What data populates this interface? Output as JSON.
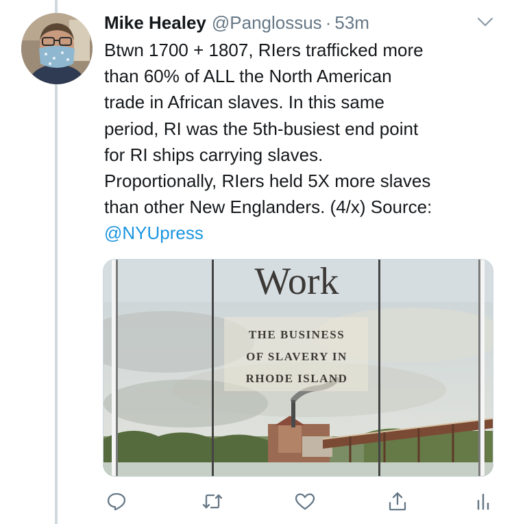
{
  "tweet": {
    "display_name": "Mike Healey",
    "handle": "@Panglossus",
    "separator": "·",
    "time": "53m",
    "text_lines": [
      "Btwn 1700 + 1807, RIers trafficked more",
      "than 60% of ALL the North American",
      "trade in African slaves. In this same",
      "period, RI was the 5th-busiest end point",
      "for RI ships carrying slaves.",
      "Proportionally, RIers held 5X more slaves",
      "than other New Englanders. (4/x) Source:"
    ],
    "mention": "@NYUpress"
  },
  "media": {
    "cover_title": "Work",
    "subtitle_lines": [
      "THE BUSINESS",
      "OF SLAVERY IN",
      "RHODE ISLAND"
    ]
  },
  "colors": {
    "text": "#14171a",
    "secondary": "#657786",
    "link": "#1b95e0",
    "thread_line": "#cfd9de"
  },
  "icons": {
    "reply": "reply-icon",
    "retweet": "retweet-icon",
    "like": "heart-icon",
    "share": "share-icon",
    "analytics": "analytics-icon",
    "caret": "chevron-down-icon"
  }
}
